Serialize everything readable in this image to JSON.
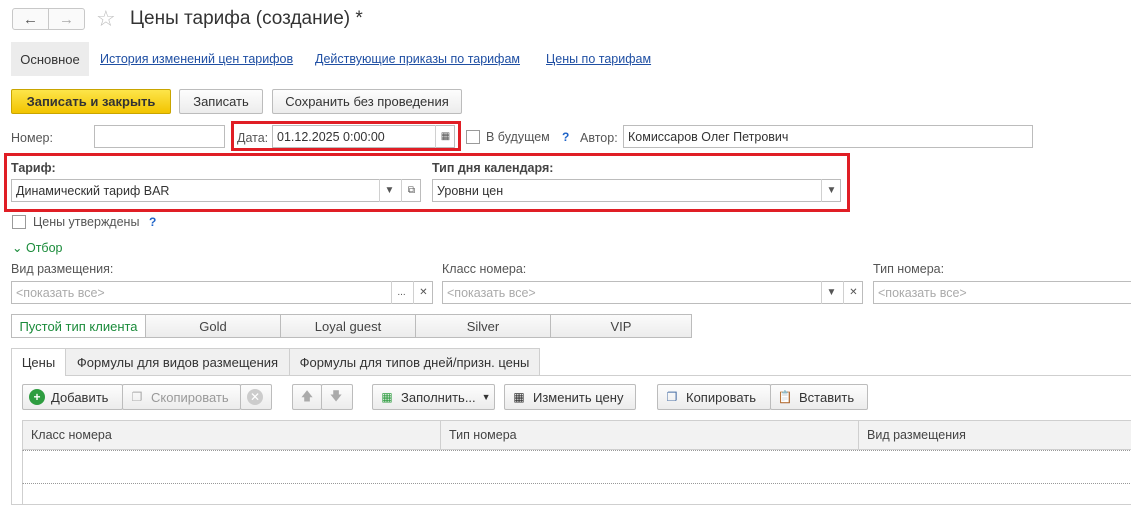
{
  "header": {
    "title": "Цены тарифа (создание) *"
  },
  "nav_tabs": {
    "main": "Основное",
    "links": [
      "История изменений цен тарифов",
      "Действующие приказы по тарифам",
      "Цены по тарифам"
    ]
  },
  "toolbar": {
    "save_close": "Записать и закрыть",
    "save": "Записать",
    "save_no_post": "Сохранить без проведения"
  },
  "form": {
    "number_label": "Номер:",
    "number_value": "",
    "date_label": "Дата:",
    "date_value": "01.12.2025  0:00:00",
    "future_label": "В будущем",
    "help_mark": "?",
    "author_label": "Автор:",
    "author_value": "Комиссаров Олег Петрович",
    "tariff_label": "Тариф:",
    "tariff_value": "Динамический тариф BAR",
    "calendar_label": "Тип дня календаря:",
    "calendar_value": "Уровни цен",
    "approved_label": "Цены утверждены"
  },
  "filter": {
    "toggle_label": "Отбор",
    "placement_label": "Вид размещения:",
    "room_class_label": "Класс номера:",
    "room_type_label": "Тип номера:",
    "placeholder": "<показать все>"
  },
  "client_types": [
    "Пустой тип клиента",
    "Gold",
    "Loyal guest",
    "Silver",
    "VIP"
  ],
  "page_tabs": [
    "Цены",
    "Формулы для видов размещения",
    "Формулы для типов дней/призн. цены"
  ],
  "table_toolbar": {
    "add": "Добавить",
    "copy": "Скопировать",
    "fill": "Заполнить...",
    "change_price": "Изменить цену",
    "copy2": "Копировать",
    "paste": "Вставить"
  },
  "table": {
    "columns": [
      "Класс номера",
      "Тип номера",
      "Вид размещения"
    ]
  },
  "colors": {
    "accent_yellow": "#f2c400",
    "highlight_red": "#e01e25",
    "link_blue": "#1f4fa3",
    "active_green": "#1a8b3a"
  }
}
